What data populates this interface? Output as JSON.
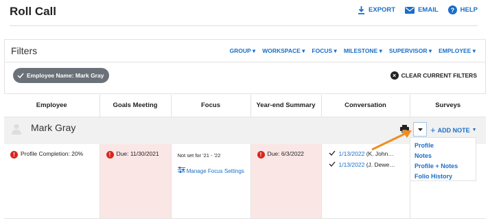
{
  "header": {
    "title": "Roll Call",
    "export_label": "EXPORT",
    "email_label": "EMAIL",
    "help_label": "HELP"
  },
  "filters": {
    "title": "Filters",
    "menu": [
      "GROUP",
      "WORKSPACE",
      "FOCUS",
      "MILESTONE",
      "SUPERVISOR",
      "EMPLOYEE"
    ],
    "chip_label": "Employee Name: Mark Gray",
    "clear_label": "CLEAR CURRENT FILTERS"
  },
  "table": {
    "headers": [
      "Employee",
      "Goals Meeting",
      "Focus",
      "Year-end Summary",
      "Conversation",
      "Surveys"
    ],
    "employee_name": "Mark Gray",
    "add_note_label": "ADD NOTE",
    "row": {
      "profile_completion": "Profile Completion: 20%",
      "goals_due": "Due: 11/30/2021",
      "focus_status": "Not set for '21 - '22",
      "focus_link": "Manage Focus Settings",
      "yearend_due": "Due: 6/3/2022",
      "conversations": [
        {
          "date": "1/13/2022",
          "person": "(K. John…"
        },
        {
          "date": "1/13/2022",
          "person": "(J. Dewe…"
        }
      ]
    },
    "dropdown_items": [
      "Profile",
      "Notes",
      "Profile + Notes",
      "Folio History"
    ]
  },
  "colors": {
    "accent": "#1a6ec7",
    "alert": "#d9261c",
    "highlight_bg": "#fbe6e6",
    "arrow": "#f08c1e"
  }
}
